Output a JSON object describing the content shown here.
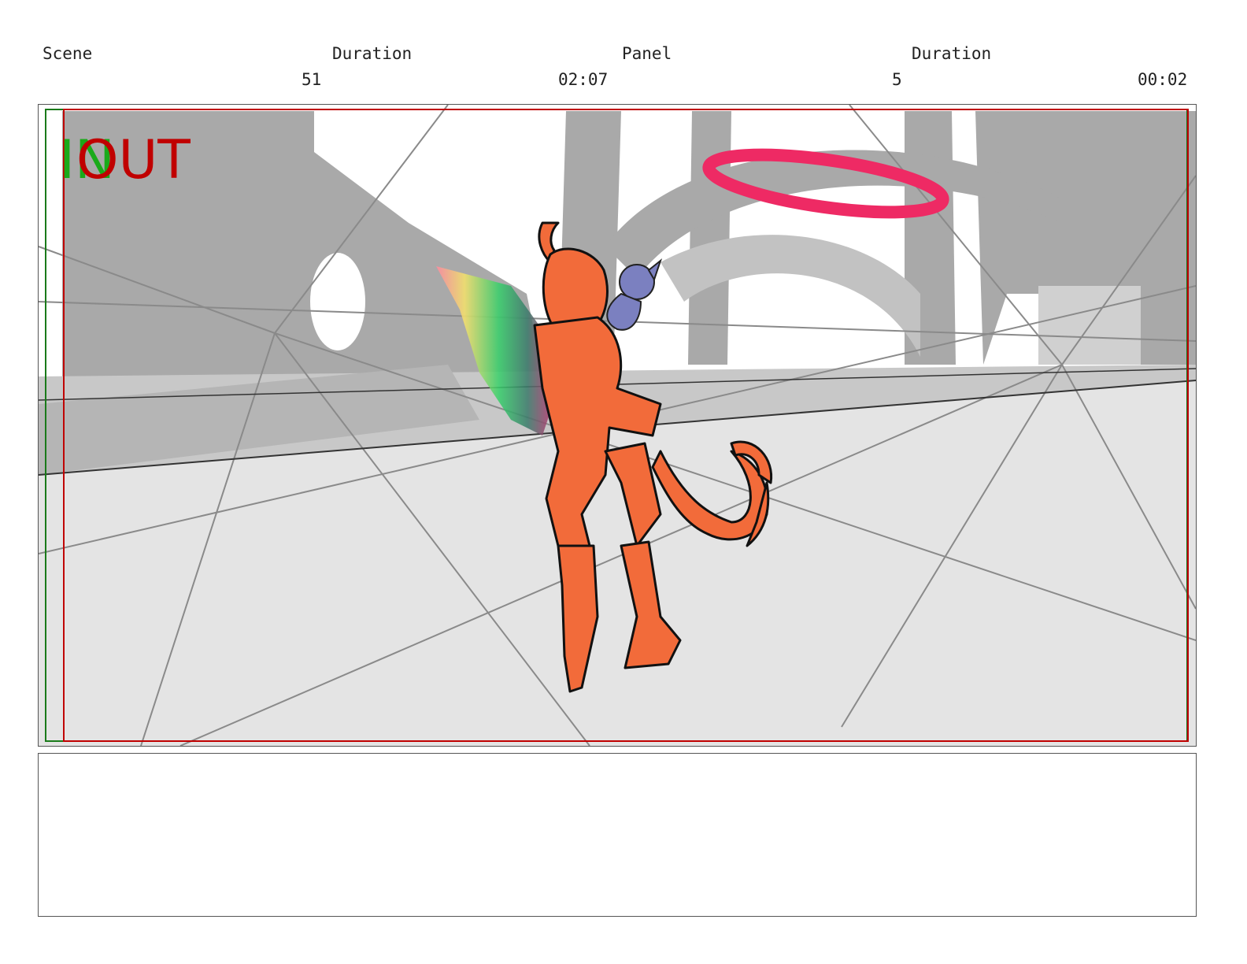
{
  "header": {
    "scene_label": "Scene",
    "scene_duration_label": "Duration",
    "panel_label": "Panel",
    "panel_duration_label": "Duration",
    "scene_number": "51",
    "scene_duration": "02:07",
    "panel_number": "5",
    "panel_duration": "00:02"
  },
  "frame": {
    "in_marker": "IN",
    "out_marker": "OUT",
    "in_color": "#1aaa1a",
    "out_color": "#c00000"
  },
  "notes": {
    "text": ""
  },
  "colors": {
    "character": "#f26b3a",
    "creature": "#7b80c0",
    "ring": "#ee2a64",
    "wall": "#a8a8a8",
    "floor": "#e6e6e6"
  }
}
